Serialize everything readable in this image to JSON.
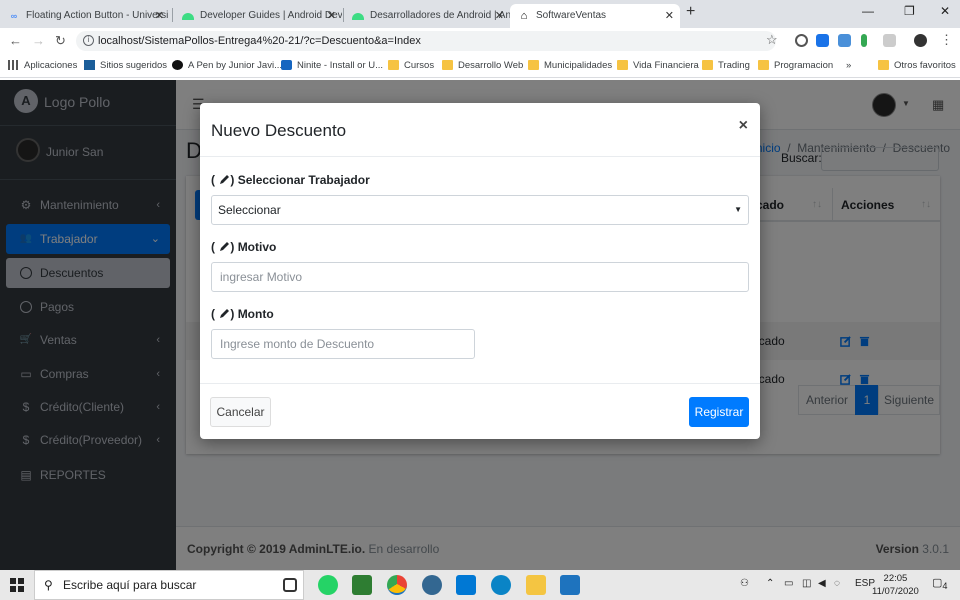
{
  "browser": {
    "tabs": [
      {
        "title": "Floating Action Button - Universi",
        "favicon": "infinity-icon",
        "color": "#4f8ef7"
      },
      {
        "title": "Developer Guides | Android Dev",
        "favicon": "android-icon",
        "color": "#3ddc84"
      },
      {
        "title": "Desarrolladores de Android | An",
        "favicon": "android-icon",
        "color": "#3ddc84"
      },
      {
        "title": "SoftwareVentas",
        "favicon": "home-icon",
        "color": "#000000"
      }
    ],
    "new_tab": "+",
    "url": "localhost/SistemaPollos-Entrega4%20-21/?c=Descuento&a=Index",
    "bookmarks": {
      "apps": "Aplicaciones",
      "items": [
        "Sitios sugeridos",
        "A Pen by Junior Javi...",
        "Ninite - Install or U...",
        "Cursos",
        "Desarrollo Web",
        "Municipalidades",
        "Vida Financiera",
        "Trading",
        "Programacion"
      ],
      "overflow": "»",
      "other": "Otros favoritos"
    }
  },
  "sidebar": {
    "brand": "Logo Pollo",
    "brand_initial": "A",
    "user_name": "Junior San",
    "items": [
      {
        "label": "Mantenimiento",
        "icon": "gears-icon",
        "glyph": "⚙",
        "chevron": "‹"
      },
      {
        "label": "Trabajador",
        "icon": "users-icon",
        "glyph": "👥",
        "chevron": "⌄"
      },
      {
        "label": "Descuentos",
        "icon": "circle-icon",
        "glyph": "",
        "chevron": ""
      },
      {
        "label": "Pagos",
        "icon": "circle-icon",
        "glyph": "",
        "chevron": ""
      },
      {
        "label": "Ventas",
        "icon": "cart-icon",
        "glyph": "🛒",
        "chevron": "‹"
      },
      {
        "label": "Compras",
        "icon": "box-icon",
        "glyph": "▭",
        "chevron": "‹"
      },
      {
        "label": "Crédito(Cliente)",
        "icon": "money-icon",
        "glyph": "$",
        "chevron": "‹"
      },
      {
        "label": "Crédito(Proveedor)",
        "icon": "money-icon",
        "glyph": "$",
        "chevron": "‹"
      },
      {
        "label": "REPORTES",
        "icon": "file-icon",
        "glyph": "▤",
        "chevron": ""
      }
    ]
  },
  "page": {
    "title_initial": "D",
    "breadcrumb": {
      "home": "Inicio",
      "sep": "/",
      "section": "Mantenimiento",
      "current": "Descuento"
    },
    "search_label": "Buscar:",
    "columns": {
      "estado_fragment": "cado",
      "acciones": "Acciones"
    },
    "rows": [
      {
        "estado_fragment": "icado"
      },
      {
        "estado_fragment": "icado"
      }
    ],
    "pagination": {
      "prev": "Anterior",
      "page": "1",
      "next": "Siguiente"
    },
    "footer": {
      "copyright": "Copyright © 2019 AdminLTE.io.",
      "suffix": " En desarrollo",
      "version_label": "Version",
      "version": "3.0.1"
    }
  },
  "modal": {
    "title": "Nuevo Descuento",
    "close": "×",
    "fields": {
      "trabajador": {
        "label": "Seleccionar Trabajador",
        "value": "Seleccionar"
      },
      "motivo": {
        "label": "Motivo",
        "placeholder": "ingresar Motivo"
      },
      "monto": {
        "label": "Monto",
        "placeholder": "Ingrese monto de Descuento"
      }
    },
    "paren_open": "(",
    "paren_close": ")",
    "cancel": "Cancelar",
    "submit": "Registrar"
  },
  "taskbar": {
    "search_placeholder": "Escribe aquí para buscar",
    "lang": "ESP",
    "time": "22:05",
    "date": "11/07/2020",
    "notifications": "4"
  },
  "colors": {
    "primary": "#007bff",
    "sidebar": "#343a40"
  }
}
